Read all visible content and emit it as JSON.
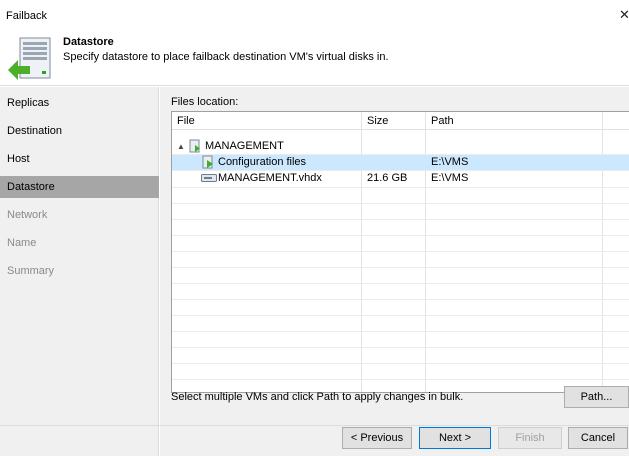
{
  "window": {
    "title": "Failback"
  },
  "header": {
    "title": "Datastore",
    "subtitle": "Specify datastore to place failback destination VM's virtual disks in."
  },
  "steps": [
    {
      "label": "Replicas",
      "state": "done"
    },
    {
      "label": "Destination",
      "state": "done"
    },
    {
      "label": "Host",
      "state": "done"
    },
    {
      "label": "Datastore",
      "state": "active"
    },
    {
      "label": "Network",
      "state": "disabled"
    },
    {
      "label": "Name",
      "state": "disabled"
    },
    {
      "label": "Summary",
      "state": "disabled"
    }
  ],
  "files": {
    "label": "Files location:",
    "columns": [
      "File",
      "Size",
      "Path"
    ],
    "rows": [
      {
        "file": "MANAGEMENT",
        "size": "",
        "path": "",
        "icon": "vm-icon",
        "expand": "▲"
      },
      {
        "file": "Configuration files",
        "size": "",
        "path": "E:\\VMS",
        "icon": "config-files-icon",
        "selected": true
      },
      {
        "file": "MANAGEMENT.vhdx",
        "size": "21.6 GB",
        "path": "E:\\VMS",
        "icon": "disk-icon"
      }
    ]
  },
  "hint": "Select multiple VMs and click Path to apply changes in bulk.",
  "buttons": {
    "path": "Path...",
    "previous": "< Previous",
    "next": "Next >",
    "finish": "Finish",
    "cancel": "Cancel"
  },
  "colors": {
    "selection": "#cce8ff",
    "active_step": "#a6a6a6",
    "accent_green": "#4caf2a"
  }
}
